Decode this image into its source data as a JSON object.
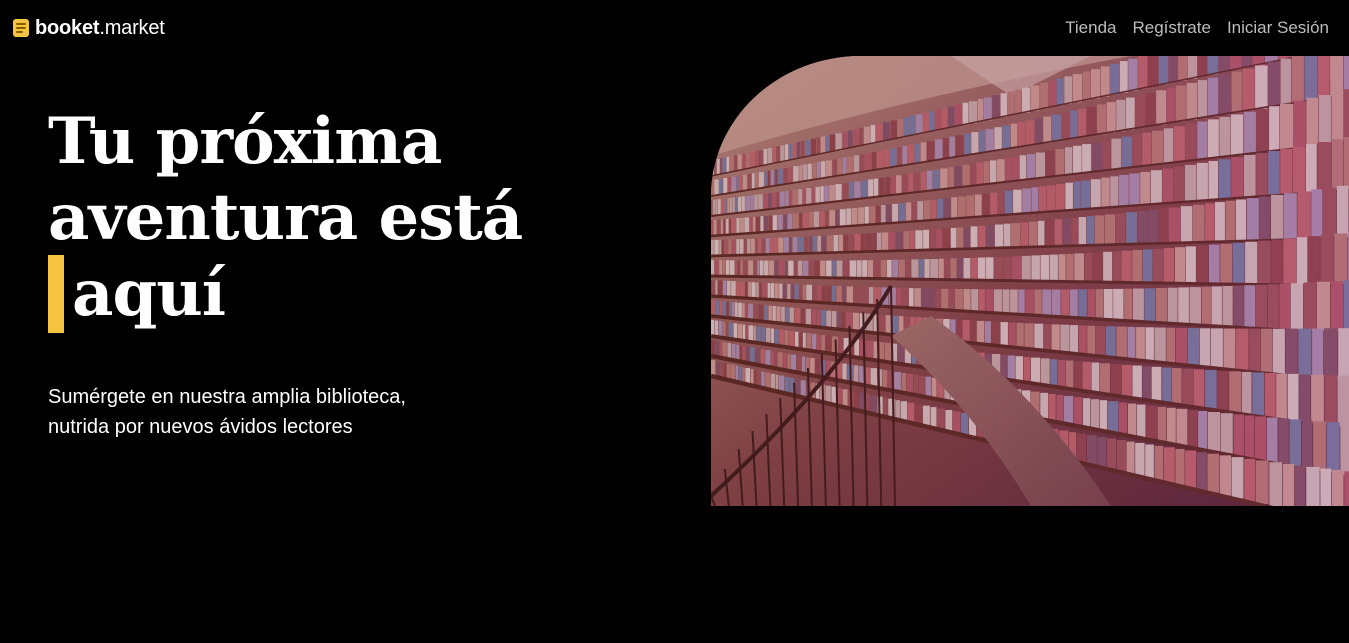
{
  "brand": {
    "name_bold": "booket",
    "name_light": ".market",
    "icon": "book-icon",
    "accent_color": "#f5c542"
  },
  "nav": {
    "items": [
      {
        "label": "Tienda"
      },
      {
        "label": "Regístrate"
      },
      {
        "label": "Iniciar Sesión"
      }
    ]
  },
  "hero": {
    "title_line1": "Tu próxima",
    "title_line2": "aventura está",
    "title_line3": "aquí",
    "subtitle_line1": "Sumérgete en nuestra amplia biblioteca,",
    "subtitle_line2": "nutrida por nuevos ávidos lectores",
    "image": "library-bookshelves-image"
  }
}
